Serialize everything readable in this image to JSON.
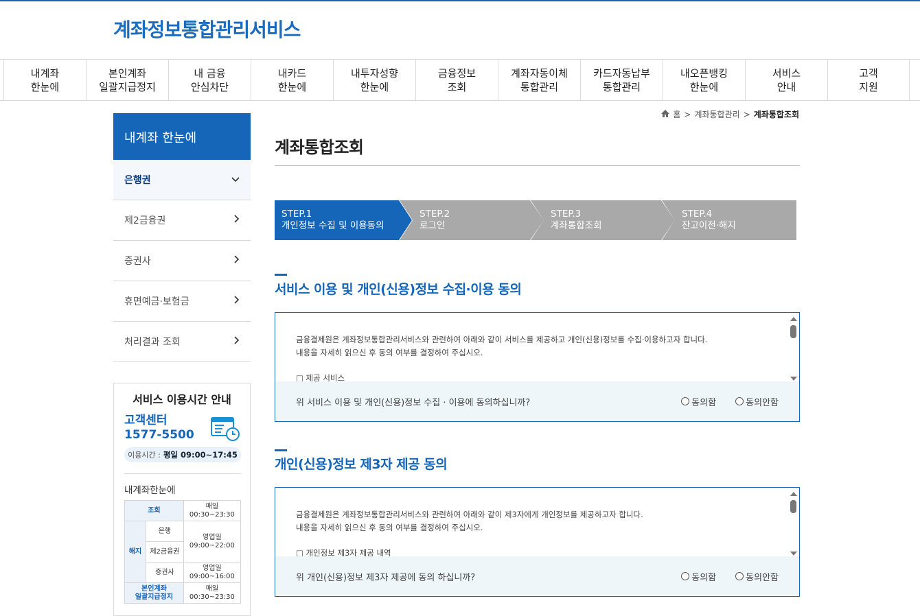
{
  "site": {
    "title": "계좌정보통합관리서비스"
  },
  "gnb": [
    {
      "line1": "내계좌",
      "line2": "한눈에"
    },
    {
      "line1": "본인계좌",
      "line2": "일괄지급정지"
    },
    {
      "line1": "내 금융",
      "line2": "안심차단"
    },
    {
      "line1": "내카드",
      "line2": "한눈에"
    },
    {
      "line1": "내투자성향",
      "line2": "한눈에"
    },
    {
      "line1": "금융정보",
      "line2": "조회"
    },
    {
      "line1": "계좌자동이체",
      "line2": "통합관리"
    },
    {
      "line1": "카드자동납부",
      "line2": "통합관리"
    },
    {
      "line1": "내오픈뱅킹",
      "line2": "한눈에"
    },
    {
      "line1": "서비스",
      "line2": "안내"
    },
    {
      "line1": "고객",
      "line2": "지원"
    }
  ],
  "sidebar": {
    "title": "내계좌 한눈에",
    "items": [
      {
        "label": "은행권",
        "chevron": "⌄"
      },
      {
        "label": "제2금융권",
        "chevron": "›"
      },
      {
        "label": "증권사",
        "chevron": "›"
      },
      {
        "label": "휴면예금·보험금",
        "chevron": "›"
      },
      {
        "label": "처리결과 조회",
        "chevron": "›"
      }
    ]
  },
  "service_info": {
    "title": "서비스 이용시간 안내",
    "cs_label": "고객센터",
    "cs_phone": "1577-5500",
    "hours_label": "이용시간 :",
    "hours_value": "평일 09:00~17:45",
    "subtitle": "내계좌한눈에",
    "table": {
      "inquiry": "조회",
      "inquiry_time_1": "매일",
      "inquiry_time_2": "00:30~23:30",
      "cancel": "해지",
      "bank": "은행",
      "bank_time_1": "영업일",
      "bank_time_2": "09:00~22:00",
      "second": "제2금융권",
      "securities": "증권사",
      "securities_time_1": "영업일",
      "securities_time_2": "09:00~16:00",
      "stop_1": "본인계좌",
      "stop_2": "일괄지급정지",
      "stop_time_1": "매일",
      "stop_time_2": "00:30~23:30"
    }
  },
  "breadcrumb": {
    "home": "홈",
    "sep": ">",
    "level1": "계좌통합관리",
    "current": "계좌통합조회"
  },
  "page_title": "계좌통합조회",
  "steps": [
    {
      "step": "STEP.1",
      "label": "개인정보 수집 및 이용동의",
      "active": true
    },
    {
      "step": "STEP.2",
      "label": "로그인",
      "active": false
    },
    {
      "step": "STEP.3",
      "label": "계좌통합조회",
      "active": false
    },
    {
      "step": "STEP.4",
      "label": "잔고이전·해지",
      "active": false
    }
  ],
  "section1": {
    "title": "서비스 이용 및 개인(신용)정보 수집·이용 동의",
    "text_line1": "금융결제원은 계좌정보통합관리서비스와 관련하여 아래와 같이 서비스를 제공하고 개인(신용)정보를 수집·이용하고자 합니다.",
    "text_line2": "내용을 자세히 읽으신 후 동의 여부를 결정하여 주십시오.",
    "item": "□ 제공 서비스",
    "question": "위 서비스 이용 및 개인(신용)정보 수집 · 이용에 동의하십니까?",
    "agree": "동의함",
    "disagree": "동의안함"
  },
  "section2": {
    "title": "개인(신용)정보 제3자 제공 동의",
    "text_line1": "금융결제원은 계좌정보통합관리서비스와 관련하여 아래와 같이 제3자에게 개인정보를 제공하고자 합니다.",
    "text_line2": "내용을 자세히 읽으신 후 동의 여부를 결정하여 주십시오.",
    "item": "□ 개인정보 제3자 제공 내역",
    "question": "위 개인(신용)정보 제3자 제공에 동의 하십니까?",
    "agree": "동의함",
    "disagree": "동의안함"
  },
  "colors": {
    "brand": "#1565b8",
    "step_active": "#1565b8",
    "step_inactive": "#a9a9a9"
  }
}
